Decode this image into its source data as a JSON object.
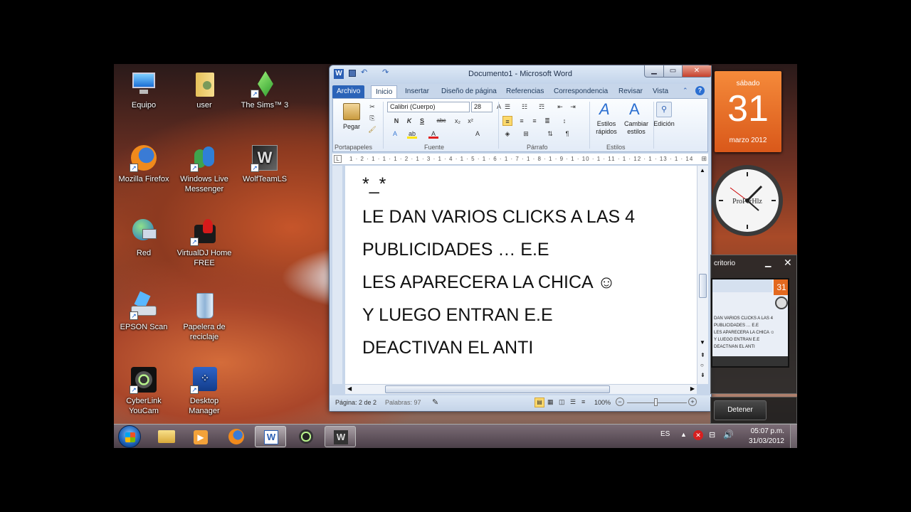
{
  "desktop_icons": [
    {
      "label": "Equipo",
      "icon": "computer-icon"
    },
    {
      "label": "user",
      "icon": "user-folder-icon"
    },
    {
      "label": "The Sims™ 3",
      "icon": "sims-icon"
    },
    {
      "label": "Mozilla Firefox",
      "icon": "firefox-icon"
    },
    {
      "label": "Windows Live Messenger",
      "icon": "messenger-icon"
    },
    {
      "label": "WolfTeamLS",
      "icon": "wolfteam-icon"
    },
    {
      "label": "Red",
      "icon": "network-icon"
    },
    {
      "label": "VirtualDJ Home FREE",
      "icon": "virtualdj-icon"
    },
    {
      "label": "EPSON Scan",
      "icon": "scanner-icon"
    },
    {
      "label": "Papelera de reciclaje",
      "icon": "recycle-bin-icon"
    },
    {
      "label": "CyberLink YouCam",
      "icon": "webcam-icon"
    },
    {
      "label": "Desktop Manager",
      "icon": "blackberry-icon"
    }
  ],
  "word": {
    "title": "Documento1 - Microsoft Word",
    "tabs": [
      "Archivo",
      "Inicio",
      "Insertar",
      "Diseño de página",
      "Referencias",
      "Correspondencia",
      "Revisar",
      "Vista"
    ],
    "ribbon": {
      "paste": "Pegar",
      "font_name": "Calibri (Cuerpo)",
      "font_size": "28",
      "styles": "Estilos rápidos",
      "change_styles": "Cambiar estilos",
      "editing": "Edición",
      "groups": [
        "Portapapeles",
        "Fuente",
        "Párrafo",
        "Estilos"
      ]
    },
    "ruler": "1 · 2 · 1 · 1 · 1 · 2 · 1 · 3 · 1 · 4 · 1 · 5 · 1 · 6 · 1 · 7 · 1 · 8 · 1 · 9 · 1 · 10 · 1 · 11 · 1 · 12 · 1 · 13 · 1 · 14",
    "document_lines": [
      "*_*",
      "LE DAN VARIOS CLICKS A LAS 4",
      "PUBLICIDADES … E.E",
      "LES APARECERA LA CHICA ☺",
      "Y LUEGO ENTRAN E.E",
      "DEACTIVAN EL ANTI"
    ],
    "status": {
      "page": "Página: 2 de 2",
      "words": "Palabras: 97",
      "zoom": "100%"
    }
  },
  "calendar": {
    "day_name": "sábado",
    "day": "31",
    "month_year": "marzo 2012"
  },
  "clock": {
    "brand": "ProPerHlz"
  },
  "preview_gadget": {
    "title": "critorio",
    "thumb_lines": [
      "DAN VARIOS CLICKS A LAS 4",
      "PUBLICIDADES … E.E",
      "LES APARECERA LA CHICA ☺",
      "Y LUEGO ENTRAN E.E",
      "DEACTIVAN EL ANTI"
    ],
    "thumb_day": "31",
    "stop_button": "Detener"
  },
  "taskbar": {
    "lang": "ES",
    "time": "05:07 p.m.",
    "date": "31/03/2012"
  }
}
